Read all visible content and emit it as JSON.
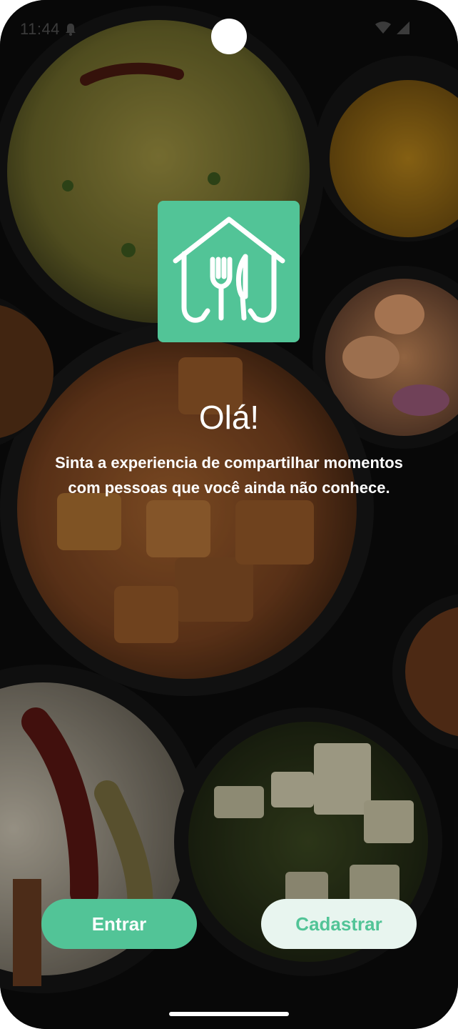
{
  "status_bar": {
    "time": "11:44"
  },
  "welcome": {
    "title": "Olá!",
    "subtitle": "Sinta a experiencia de compartilhar momentos com pessoas que você ainda não conhece."
  },
  "actions": {
    "login_label": "Entrar",
    "signup_label": "Cadastrar"
  },
  "colors": {
    "brand": "#52c497",
    "secondary_button_bg": "#e8f5ef",
    "text": "#ffffff",
    "background": "#0b0b0b"
  },
  "icons": {
    "logo": "house-fork-knife-icon",
    "notification": "bell-icon",
    "wifi": "wifi-icon",
    "signal": "signal-icon"
  }
}
